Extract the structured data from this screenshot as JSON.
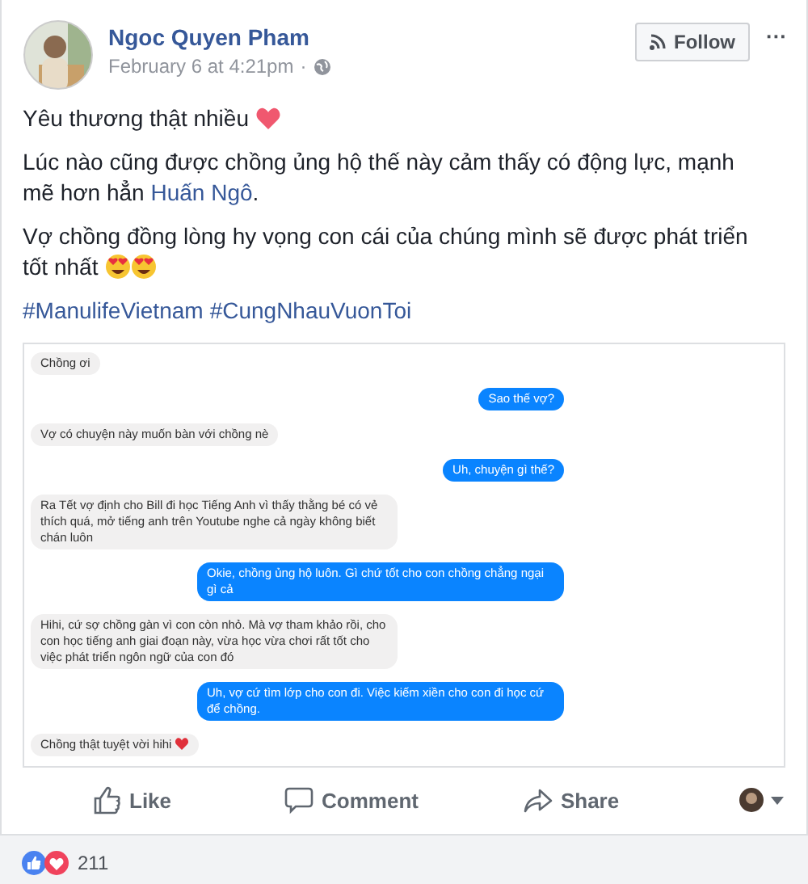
{
  "post": {
    "author": "Ngoc Quyen Pham",
    "timestamp": "February 6 at 4:21pm",
    "separator": "·",
    "follow_label": "Follow",
    "more_label": "···",
    "lines": [
      {
        "kind": "heart",
        "text": "Yêu thương thật nhiều"
      },
      {
        "kind": "mention",
        "text": "Lúc nào cũng được chồng ủng hộ thế này cảm thấy có động lực, mạnh mẽ hơn hẳn ",
        "mention": "Huấn Ngô",
        "after": "."
      },
      {
        "kind": "hearteyes",
        "text": "Vợ chồng đồng lòng hy vọng con cái của chúng mình sẽ được phát triển tốt nhất"
      }
    ],
    "hashtags": [
      "#ManulifeVietnam",
      "#CungNhauVuonToi"
    ]
  },
  "chat": [
    {
      "kind": "left",
      "text": "Chồng ơi"
    },
    {
      "kind": "right",
      "text": "Sao thế vợ?"
    },
    {
      "kind": "left",
      "text": "Vợ có chuyện này muốn bàn với chồng nè"
    },
    {
      "kind": "right",
      "text": "Uh, chuyện gì thế?"
    },
    {
      "kind": "left",
      "text": "Ra Tết vợ định cho Bill đi học Tiếng Anh vì thấy thằng bé có vẻ thích quá, mở tiếng anh trên Youtube nghe cả ngày không biết chán luôn"
    },
    {
      "kind": "right",
      "text": "Okie, chồng ủng hộ luôn. Gì chứ tốt cho con chồng chẳng ngại gì cả"
    },
    {
      "kind": "left",
      "text": "Hihi, cứ sợ chồng gàn vì con còn nhỏ. Mà vợ tham khảo rồi, cho con học tiếng anh giai đoạn này, vừa học vừa chơi rất tốt cho việc phát triển ngôn ngữ của con đó"
    },
    {
      "kind": "right",
      "text": "Uh, vợ cứ tìm lớp cho con đi. Việc kiếm xiền cho con đi học cứ để chồng."
    },
    {
      "kind": "left",
      "heart": true,
      "text": "Chồng thật tuyệt vời hihi"
    }
  ],
  "actions": [
    {
      "kind": "like",
      "label": "Like"
    },
    {
      "kind": "comment",
      "label": "Comment"
    },
    {
      "kind": "share",
      "label": "Share"
    }
  ],
  "reactions": {
    "count": "211"
  }
}
